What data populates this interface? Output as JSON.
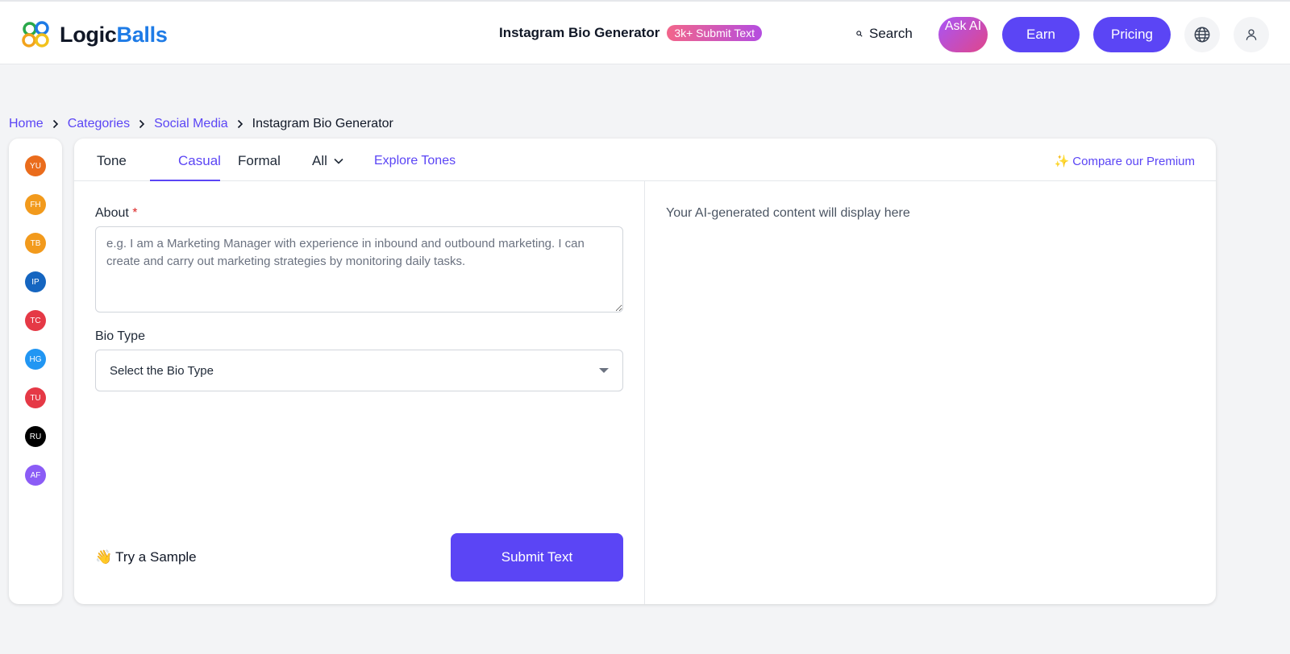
{
  "header": {
    "logo_part1": "Logic",
    "logo_part2": "Balls",
    "title": "Instagram Bio Generator",
    "badge": "3k+ Submit Text",
    "search_label": "Search",
    "ask_ai_label": "Ask AI",
    "earn_label": "Earn",
    "pricing_label": "Pricing",
    "icons": [
      "search-icon",
      "globe-icon",
      "user-icon"
    ]
  },
  "breadcrumb": {
    "items": [
      "Home",
      "Categories",
      "Social Media"
    ],
    "current": "Instagram Bio Generator"
  },
  "avatars": [
    {
      "initials": "YU",
      "color": "#ea6c1c"
    },
    {
      "initials": "FH",
      "color": "#f29a1c"
    },
    {
      "initials": "TB",
      "color": "#f29a1c"
    },
    {
      "initials": "IP",
      "color": "#1565c0"
    },
    {
      "initials": "TC",
      "color": "#e53946"
    },
    {
      "initials": "HG",
      "color": "#2196f3"
    },
    {
      "initials": "TU",
      "color": "#e53946"
    },
    {
      "initials": "RU",
      "color": "#000000"
    },
    {
      "initials": "AF",
      "color": "#8b5cf6"
    }
  ],
  "tabs": {
    "tone": "Tone",
    "casual": "Casual",
    "formal": "Formal",
    "all": "All",
    "explore": "Explore Tones",
    "premium": "✨ Compare our Premium"
  },
  "form": {
    "about_label": "About",
    "about_required": "*",
    "about_placeholder": "e.g. I am a Marketing Manager with experience in inbound and outbound marketing. I can create and carry out marketing strategies by monitoring daily tasks.",
    "bio_type_label": "Bio Type",
    "bio_type_placeholder": "Select the Bio Type",
    "sample_emoji": "👋",
    "sample_label": "Try a Sample",
    "submit_label": "Submit Text"
  },
  "output": {
    "placeholder": "Your AI-generated content will display here"
  },
  "colors": {
    "accent": "#5b45f5",
    "brand_blue": "#1e7be6"
  }
}
